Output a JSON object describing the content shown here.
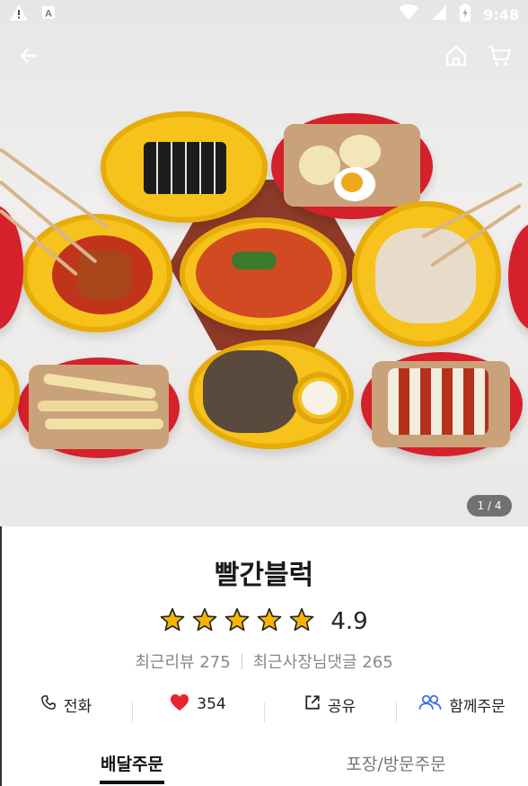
{
  "status_bar": {
    "time": "9:48"
  },
  "hero": {
    "page_counter": "1 / 4"
  },
  "store": {
    "name": "빨간블럭",
    "rating": "4.9",
    "stars": 5,
    "recent_reviews": "최근리뷰 275",
    "owner_comments": "최근사장님댓글 265"
  },
  "actions": {
    "call": "전화",
    "likes": "354",
    "share": "공유",
    "group_order": "함께주문"
  },
  "tabs": {
    "delivery": "배달주문",
    "pickup": "포장/방문주문"
  },
  "colors": {
    "star": "#f7b500",
    "heart": "#e8242f",
    "group_icon": "#3b6fe0"
  }
}
